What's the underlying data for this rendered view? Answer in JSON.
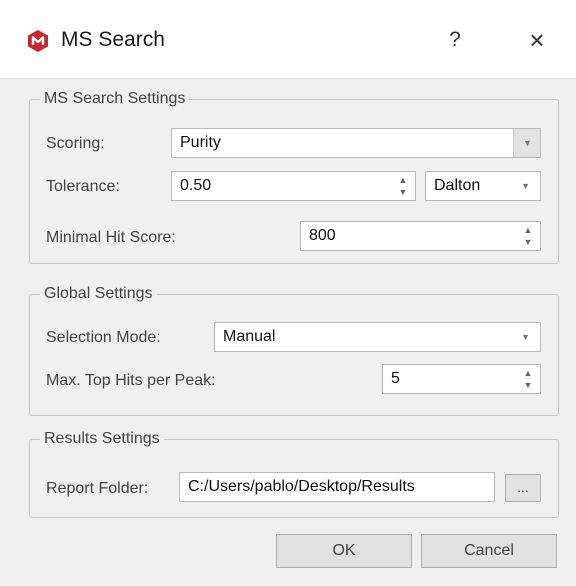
{
  "window": {
    "title": "MS Search",
    "help_label": "?",
    "close_label": "×"
  },
  "ms_search_settings": {
    "title": "MS Search Settings",
    "scoring_label": "Scoring:",
    "scoring_value": "Purity",
    "tolerance_label": "Tolerance:",
    "tolerance_value": "0.50",
    "tolerance_unit": "Dalton",
    "min_hit_score_label": "Minimal Hit Score:",
    "min_hit_score_value": "800"
  },
  "global_settings": {
    "title": "Global Settings",
    "selection_mode_label": "Selection Mode:",
    "selection_mode_value": "Manual",
    "max_top_hits_label": "Max. Top Hits per Peak:",
    "max_top_hits_value": "5"
  },
  "results_settings": {
    "title": "Results Settings",
    "report_folder_label": "Report Folder:",
    "report_folder_value": "C:/Users/pablo/Desktop/Results",
    "browse_label": "..."
  },
  "buttons": {
    "ok": "OK",
    "cancel": "Cancel"
  },
  "icons": {
    "app": "app-logo-icon",
    "help": "help-icon",
    "close": "close-icon",
    "dropdown": "chevron-down-icon",
    "spin": "spin-arrows-icon"
  },
  "colors": {
    "app_icon": "#c9252c",
    "dialog_bg": "#f0f0f0",
    "titlebar_bg": "#ffffff"
  }
}
